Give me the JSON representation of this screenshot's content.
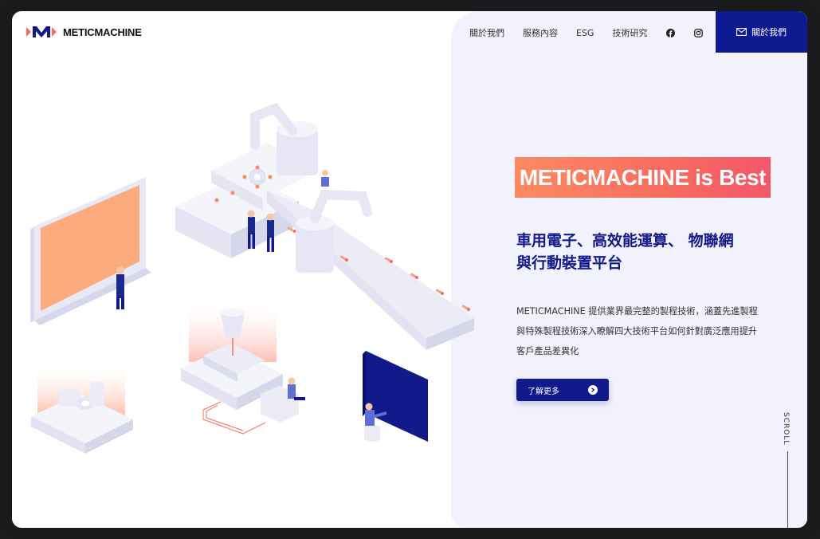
{
  "brand": {
    "name": "METICMACHINE"
  },
  "nav": {
    "items": [
      {
        "label": "關於我們"
      },
      {
        "label": "服務內容"
      },
      {
        "label": "ESG"
      },
      {
        "label": "技術研究"
      }
    ],
    "social_icons": [
      "facebook-icon",
      "instagram-icon"
    ],
    "contact_label": "關於我們"
  },
  "hero": {
    "highlight": "METICMACHINE is Best",
    "headline_line1": "車用電子、高效能運算、 物聯網",
    "headline_line2": "與行動裝置平台",
    "desc_line1": "METICMACHINE 提供業界最完整的製程技術，涵蓋先進製程",
    "desc_line2": "與特殊製程技術深入瞭解四大技術平台如何針對廣泛應用提升",
    "desc_line3": "客戶產品差異化",
    "cta_label": "了解更多"
  },
  "scroll_label": "SCROLL",
  "colors": {
    "accent": "#12198a",
    "brand_orange": "#f86c60",
    "panel_bg": "#f2f2fc"
  }
}
